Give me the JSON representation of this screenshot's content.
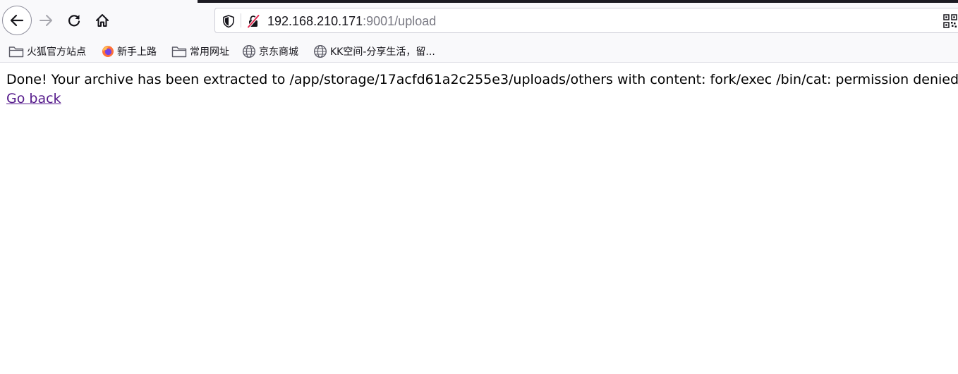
{
  "browser": {
    "url_host": "192.168.210.171",
    "url_rest": ":9001/upload"
  },
  "bookmarks": [
    {
      "label": "火狐官方站点",
      "icon": "folder-icon"
    },
    {
      "label": "新手上路",
      "icon": "firefox-icon"
    },
    {
      "label": "常用网址",
      "icon": "folder-icon"
    },
    {
      "label": "京东商城",
      "icon": "globe-icon"
    },
    {
      "label": "KK空间-分享生活，留...",
      "icon": "globe-icon"
    }
  ],
  "page": {
    "message": "Done! Your archive has been extracted to /app/storage/17acfd61a2c255e3/uploads/others with content: fork/exec /bin/cat: permission denied",
    "back_link": "Go back"
  },
  "colors": {
    "visited_link": "#551a8b",
    "toolbar_bg": "#f9f9fb",
    "insecure_red": "#e22850"
  }
}
